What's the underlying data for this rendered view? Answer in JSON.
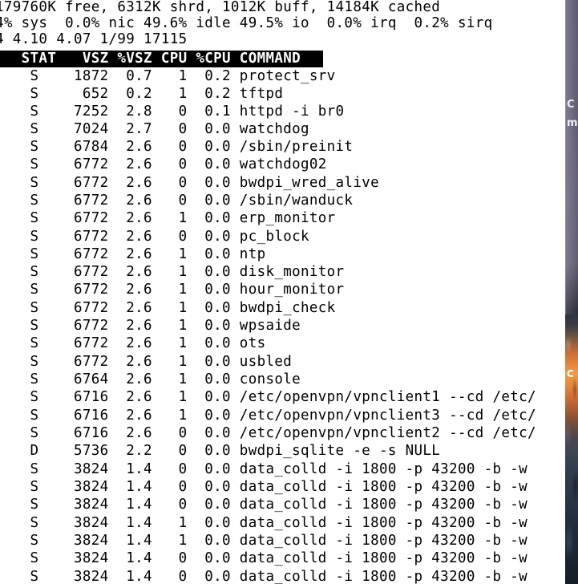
{
  "app": {
    "kind": "terminal-emulator",
    "program": "top",
    "background_color": "#ffffff",
    "foreground_color": "#000000",
    "highlight_background": "#000000",
    "highlight_foreground": "#ffffff"
  },
  "desktop": {
    "wallpaper_sliver_colors": [
      "#6d6781",
      "#f09a4a",
      "#2f3c4c",
      "#141d28"
    ],
    "background_window_glyphs": [
      "C",
      "m",
      "C"
    ]
  },
  "summary_lines": [
    "179760K free, 6312K shrd, 1012K buff, 14184K cached",
    "4% sys  0.0% nic 49.6% idle 49.5% io  0.0% irq  0.2% sirq",
    "4 4.10 4.07 1/99 17115"
  ],
  "table": {
    "header_text": "   STAT   VSZ %VSZ CPU %CPU COMMAND",
    "columns": [
      "STAT",
      "VSZ",
      "%VSZ",
      "CPU",
      "%CPU",
      "COMMAND"
    ],
    "rows": [
      {
        "stat": "S",
        "vsz": "1872",
        "pvsz": "0.7",
        "cpu": "1",
        "pcpu": "0.2",
        "command": "protect_srv"
      },
      {
        "stat": "S",
        "vsz": "652",
        "pvsz": "0.2",
        "cpu": "1",
        "pcpu": "0.2",
        "command": "tftpd"
      },
      {
        "stat": "S",
        "vsz": "7252",
        "pvsz": "2.8",
        "cpu": "0",
        "pcpu": "0.1",
        "command": "httpd -i br0"
      },
      {
        "stat": "S",
        "vsz": "7024",
        "pvsz": "2.7",
        "cpu": "0",
        "pcpu": "0.0",
        "command": "watchdog"
      },
      {
        "stat": "S",
        "vsz": "6784",
        "pvsz": "2.6",
        "cpu": "0",
        "pcpu": "0.0",
        "command": "/sbin/preinit"
      },
      {
        "stat": "S",
        "vsz": "6772",
        "pvsz": "2.6",
        "cpu": "0",
        "pcpu": "0.0",
        "command": "watchdog02"
      },
      {
        "stat": "S",
        "vsz": "6772",
        "pvsz": "2.6",
        "cpu": "0",
        "pcpu": "0.0",
        "command": "bwdpi_wred_alive"
      },
      {
        "stat": "S",
        "vsz": "6772",
        "pvsz": "2.6",
        "cpu": "0",
        "pcpu": "0.0",
        "command": "/sbin/wanduck"
      },
      {
        "stat": "S",
        "vsz": "6772",
        "pvsz": "2.6",
        "cpu": "1",
        "pcpu": "0.0",
        "command": "erp_monitor"
      },
      {
        "stat": "S",
        "vsz": "6772",
        "pvsz": "2.6",
        "cpu": "0",
        "pcpu": "0.0",
        "command": "pc_block"
      },
      {
        "stat": "S",
        "vsz": "6772",
        "pvsz": "2.6",
        "cpu": "1",
        "pcpu": "0.0",
        "command": "ntp"
      },
      {
        "stat": "S",
        "vsz": "6772",
        "pvsz": "2.6",
        "cpu": "1",
        "pcpu": "0.0",
        "command": "disk_monitor"
      },
      {
        "stat": "S",
        "vsz": "6772",
        "pvsz": "2.6",
        "cpu": "1",
        "pcpu": "0.0",
        "command": "hour_monitor"
      },
      {
        "stat": "S",
        "vsz": "6772",
        "pvsz": "2.6",
        "cpu": "1",
        "pcpu": "0.0",
        "command": "bwdpi_check"
      },
      {
        "stat": "S",
        "vsz": "6772",
        "pvsz": "2.6",
        "cpu": "1",
        "pcpu": "0.0",
        "command": "wpsaide"
      },
      {
        "stat": "S",
        "vsz": "6772",
        "pvsz": "2.6",
        "cpu": "1",
        "pcpu": "0.0",
        "command": "ots"
      },
      {
        "stat": "S",
        "vsz": "6772",
        "pvsz": "2.6",
        "cpu": "1",
        "pcpu": "0.0",
        "command": "usbled"
      },
      {
        "stat": "S",
        "vsz": "6764",
        "pvsz": "2.6",
        "cpu": "1",
        "pcpu": "0.0",
        "command": "console"
      },
      {
        "stat": "S",
        "vsz": "6716",
        "pvsz": "2.6",
        "cpu": "1",
        "pcpu": "0.0",
        "command": "/etc/openvpn/vpnclient1 --cd /etc/"
      },
      {
        "stat": "S",
        "vsz": "6716",
        "pvsz": "2.6",
        "cpu": "1",
        "pcpu": "0.0",
        "command": "/etc/openvpn/vpnclient3 --cd /etc/"
      },
      {
        "stat": "S",
        "vsz": "6716",
        "pvsz": "2.6",
        "cpu": "0",
        "pcpu": "0.0",
        "command": "/etc/openvpn/vpnclient2 --cd /etc/"
      },
      {
        "stat": "D",
        "vsz": "5736",
        "pvsz": "2.2",
        "cpu": "0",
        "pcpu": "0.0",
        "command": "bwdpi_sqlite -e -s NULL"
      },
      {
        "stat": "S",
        "vsz": "3824",
        "pvsz": "1.4",
        "cpu": "0",
        "pcpu": "0.0",
        "command": "data_colld -i 1800 -p 43200 -b -w"
      },
      {
        "stat": "S",
        "vsz": "3824",
        "pvsz": "1.4",
        "cpu": "0",
        "pcpu": "0.0",
        "command": "data_colld -i 1800 -p 43200 -b -w"
      },
      {
        "stat": "S",
        "vsz": "3824",
        "pvsz": "1.4",
        "cpu": "0",
        "pcpu": "0.0",
        "command": "data_colld -i 1800 -p 43200 -b -w"
      },
      {
        "stat": "S",
        "vsz": "3824",
        "pvsz": "1.4",
        "cpu": "1",
        "pcpu": "0.0",
        "command": "data_colld -i 1800 -p 43200 -b -w"
      },
      {
        "stat": "S",
        "vsz": "3824",
        "pvsz": "1.4",
        "cpu": "1",
        "pcpu": "0.0",
        "command": "data_colld -i 1800 -p 43200 -b -w"
      },
      {
        "stat": "S",
        "vsz": "3824",
        "pvsz": "1.4",
        "cpu": "0",
        "pcpu": "0.0",
        "command": "data_colld -i 1800 -p 43200 -b -w"
      },
      {
        "stat": "S",
        "vsz": "3824",
        "pvsz": "1.4",
        "cpu": "0",
        "pcpu": "0.0",
        "command": "data_colld -i 1800 -p 43200 -b -w"
      }
    ],
    "row_lines": [
      "    S    1872  0.7   1  0.2 protect_srv",
      "    S     652  0.2   1  0.2 tftpd",
      "    S    7252  2.8   0  0.1 httpd -i br0",
      "    S    7024  2.7   0  0.0 watchdog",
      "    S    6784  2.6   0  0.0 /sbin/preinit",
      "    S    6772  2.6   0  0.0 watchdog02",
      "    S    6772  2.6   0  0.0 bwdpi_wred_alive",
      "    S    6772  2.6   0  0.0 /sbin/wanduck",
      "    S    6772  2.6   1  0.0 erp_monitor",
      "    S    6772  2.6   0  0.0 pc_block",
      "    S    6772  2.6   1  0.0 ntp",
      "    S    6772  2.6   1  0.0 disk_monitor",
      "    S    6772  2.6   1  0.0 hour_monitor",
      "    S    6772  2.6   1  0.0 bwdpi_check",
      "    S    6772  2.6   1  0.0 wpsaide",
      "    S    6772  2.6   1  0.0 ots",
      "    S    6772  2.6   1  0.0 usbled",
      "    S    6764  2.6   1  0.0 console",
      "    S    6716  2.6   1  0.0 /etc/openvpn/vpnclient1 --cd /etc/",
      "    S    6716  2.6   1  0.0 /etc/openvpn/vpnclient3 --cd /etc/",
      "    S    6716  2.6   0  0.0 /etc/openvpn/vpnclient2 --cd /etc/",
      "    D    5736  2.2   0  0.0 bwdpi_sqlite -e -s NULL",
      "    S    3824  1.4   0  0.0 data_colld -i 1800 -p 43200 -b -w",
      "    S    3824  1.4   0  0.0 data_colld -i 1800 -p 43200 -b -w",
      "    S    3824  1.4   0  0.0 data_colld -i 1800 -p 43200 -b -w",
      "    S    3824  1.4   1  0.0 data_colld -i 1800 -p 43200 -b -w",
      "    S    3824  1.4   1  0.0 data_colld -i 1800 -p 43200 -b -w",
      "    S    3824  1.4   0  0.0 data_colld -i 1800 -p 43200 -b -w",
      "    S    3824  1.4   0  0.0 data_colld -i 1800 -p 43200 -b -w"
    ]
  }
}
